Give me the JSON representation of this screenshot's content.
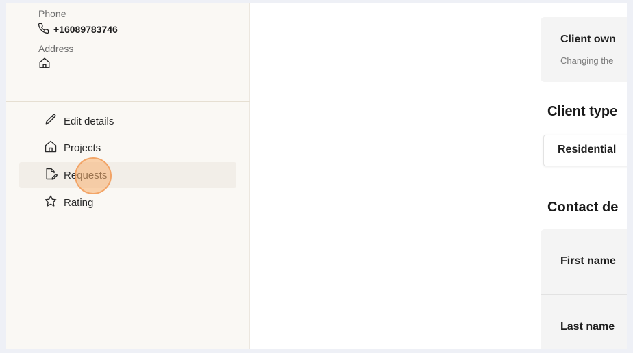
{
  "sidebar": {
    "phone_label": "Phone",
    "phone_value": "+16089783746",
    "address_label": "Address",
    "nav": [
      {
        "label": "Edit details",
        "icon": "pencil-icon"
      },
      {
        "label": "Projects",
        "icon": "home-icon"
      },
      {
        "label": "Requests",
        "icon": "document-edit-icon",
        "active": true
      },
      {
        "label": "Rating",
        "icon": "star-icon"
      }
    ]
  },
  "main": {
    "owner_card": {
      "title": "Client own",
      "subtitle": "Changing the"
    },
    "client_type": {
      "heading": "Client type",
      "selected": "Residential"
    },
    "contact": {
      "heading": "Contact de",
      "first_name_label": "First name",
      "last_name_label": "Last name"
    }
  },
  "colors": {
    "sidebar_bg": "#faf8f4",
    "active_item_bg": "#f2eee8",
    "click_marker": "#f8b070",
    "card_bg": "#f4f4f4"
  }
}
